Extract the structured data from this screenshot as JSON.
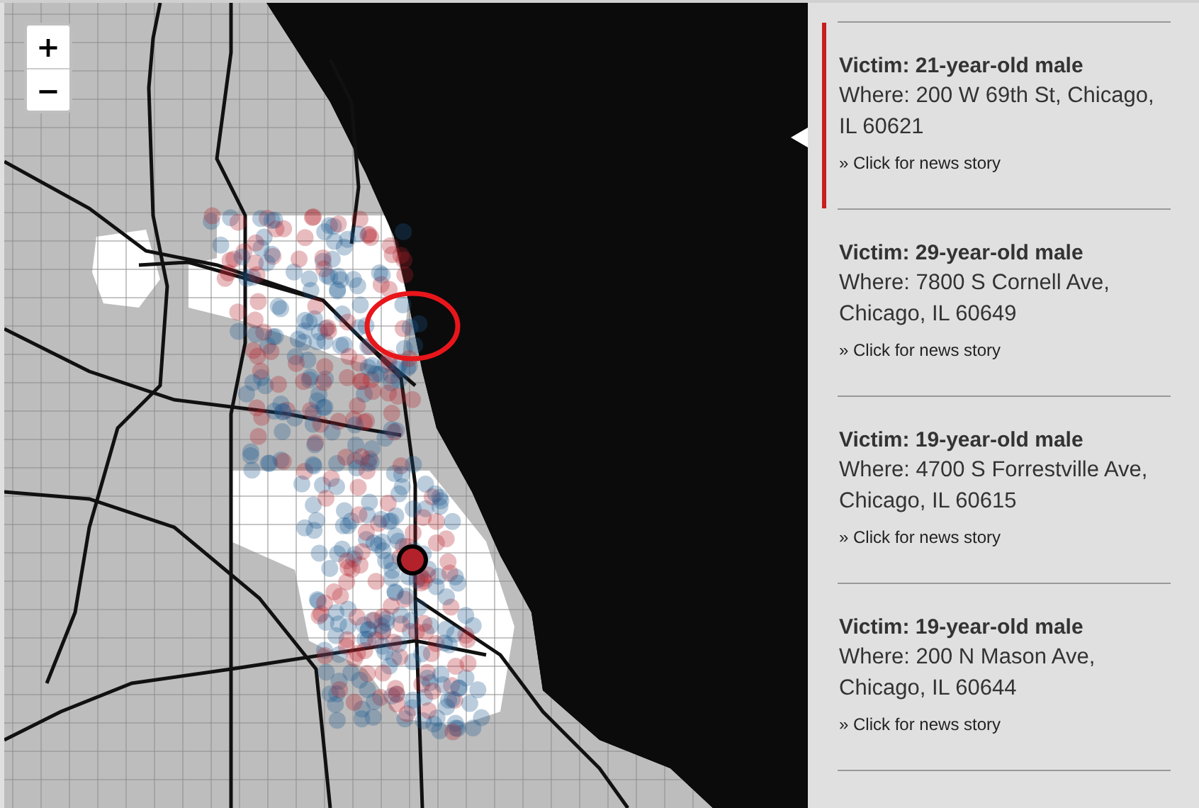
{
  "map": {
    "zoom_controls": [
      {
        "label": "+"
      },
      {
        "label": "−"
      }
    ]
  },
  "victims": [
    {
      "title": "Victim: 21-year-old male",
      "where": "Where: 200 W 69th St, Chicago, IL 60621",
      "link": "» Click for news story",
      "selected": true
    },
    {
      "title": "Victim: 29-year-old male",
      "where": "Where: 7800 S Cornell Ave, Chicago, IL 60649",
      "link": "» Click for news story",
      "selected": false
    },
    {
      "title": "Victim: 19-year-old male",
      "where": "Where: 4700 S Forrestville Ave, Chicago, IL 60615",
      "link": "» Click for news story",
      "selected": false
    },
    {
      "title": "Victim: 19-year-old male",
      "where": "Where: 200 N Mason Ave, Chicago, IL 60644",
      "link": "» Click for news story",
      "selected": false
    }
  ]
}
